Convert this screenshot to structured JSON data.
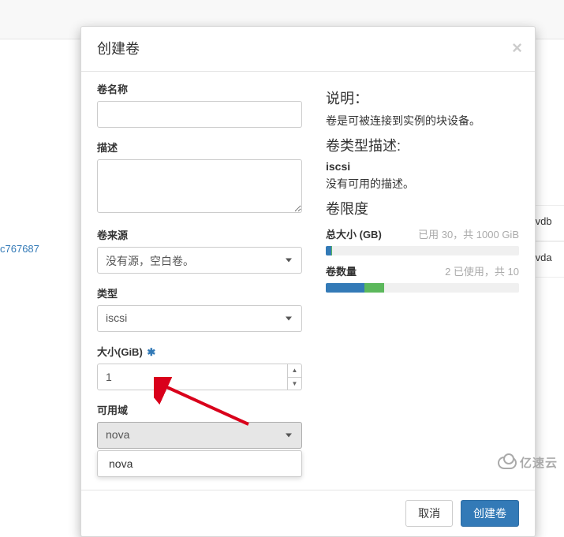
{
  "modal": {
    "title": "创建卷",
    "labels": {
      "name": "卷名称",
      "description": "描述",
      "source": "卷来源",
      "type": "类型",
      "size": "大小(GiB)",
      "az": "可用域"
    },
    "values": {
      "source": "没有源，空白卷。",
      "type": "iscsi",
      "size": "1",
      "az": "nova"
    },
    "dropdown_options": {
      "az": [
        "nova"
      ]
    },
    "side": {
      "explain_heading": "说明：",
      "explain_text": "卷是可被连接到实例的块设备。",
      "type_heading": "卷类型描述:",
      "type_name": "iscsi",
      "type_desc": "没有可用的描述。",
      "limit_heading": "卷限度"
    },
    "quotas": {
      "size": {
        "label": "总大小 (GB)",
        "info": "已用 30，共 1000 GiB",
        "used_pct": 3,
        "add_pct": 0.1
      },
      "count": {
        "label": "卷数量",
        "info": "2 已使用，共 10",
        "used_pct": 20,
        "add_pct": 10
      }
    },
    "buttons": {
      "cancel": "取消",
      "submit": "创建卷"
    }
  },
  "background": {
    "link": "c767687",
    "rows": [
      "/vdb",
      "/vda"
    ]
  },
  "watermark": "亿速云"
}
